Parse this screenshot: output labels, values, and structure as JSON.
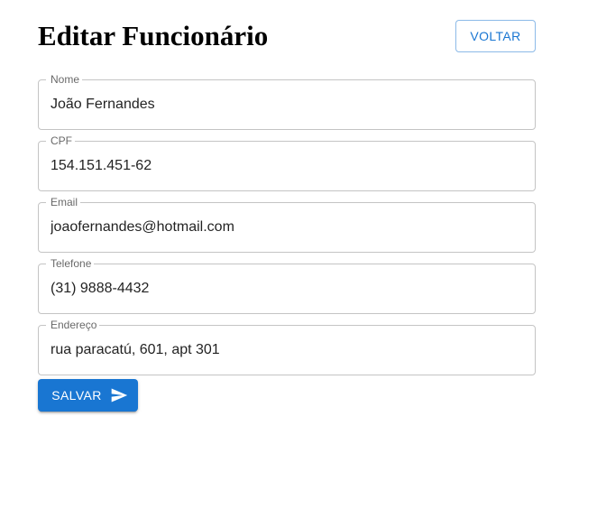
{
  "header": {
    "title": "Editar Funcionário",
    "back_label": "VOLTAR"
  },
  "form": {
    "fields": [
      {
        "label": "Nome",
        "value": "João Fernandes"
      },
      {
        "label": "CPF",
        "value": "154.151.451-62"
      },
      {
        "label": "Email",
        "value": "joaofernandes@hotmail.com"
      },
      {
        "label": "Telefone",
        "value": "(31) 9888-4432"
      },
      {
        "label": "Endereço",
        "value": "rua paracatú, 601, apt 301"
      }
    ],
    "save_label": "SALVAR",
    "save_icon": "send-icon"
  },
  "colors": {
    "primary": "#1976d2",
    "border": "#c4c4c4",
    "label": "#757575"
  }
}
